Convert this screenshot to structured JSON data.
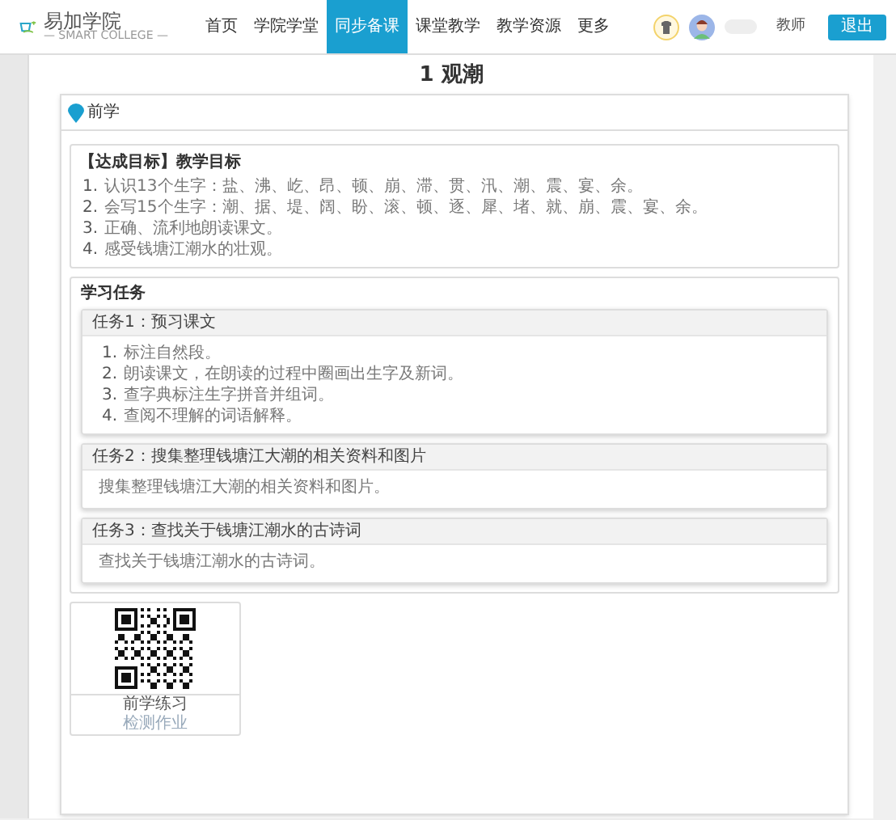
{
  "header": {
    "logo_text": "易加学院",
    "logo_subtitle": "— SMART COLLEGE —",
    "nav": [
      {
        "label": "首页",
        "selected": false
      },
      {
        "label": "学院学堂",
        "selected": false
      },
      {
        "label": "同步备课",
        "selected": true
      },
      {
        "label": "课堂教学",
        "selected": false
      },
      {
        "label": "教学资源",
        "selected": false
      },
      {
        "label": "更多",
        "selected": false
      }
    ],
    "role": "教师",
    "logout": "退出"
  },
  "page_title": "1 观潮",
  "section": {
    "title": "前学",
    "goals": {
      "heading": "【达成目标】教学目标",
      "items": [
        {
          "num": "1.",
          "text": "认识13个生字：盐、沸、屹、昂、顿、崩、滞、贯、汛、潮、震、宴、余。"
        },
        {
          "num": "2.",
          "text": "会写15个生字：潮、据、堤、阔、盼、滚、顿、逐、犀、堵、就、崩、震、宴、余。"
        },
        {
          "num": "3.",
          "text": "正确、流利地朗读课文。"
        },
        {
          "num": "4.",
          "text": "感受钱塘江潮水的壮观。"
        }
      ]
    },
    "tasks": {
      "heading": "学习任务",
      "items": [
        {
          "title": "任务1：预习课文",
          "kind": "list",
          "lines": [
            {
              "num": "1.",
              "text": "标注自然段。"
            },
            {
              "num": "2.",
              "text": "朗读课文，在朗读的过程中圈画出生字及新词。"
            },
            {
              "num": "3.",
              "text": "查字典标注生字拼音并组词。"
            },
            {
              "num": "4.",
              "text": "查阅不理解的词语解释。"
            }
          ]
        },
        {
          "title": "任务2：搜集整理钱塘江大潮的相关资料和图片",
          "kind": "text",
          "text": "搜集整理钱塘江大潮的相关资料和图片。"
        },
        {
          "title": "任务3：查找关于钱塘江潮水的古诗词",
          "kind": "text",
          "text": "查找关于钱塘江潮水的古诗词。"
        }
      ]
    },
    "exercise": {
      "title": "前学练习",
      "subtitle": "检测作业"
    }
  }
}
